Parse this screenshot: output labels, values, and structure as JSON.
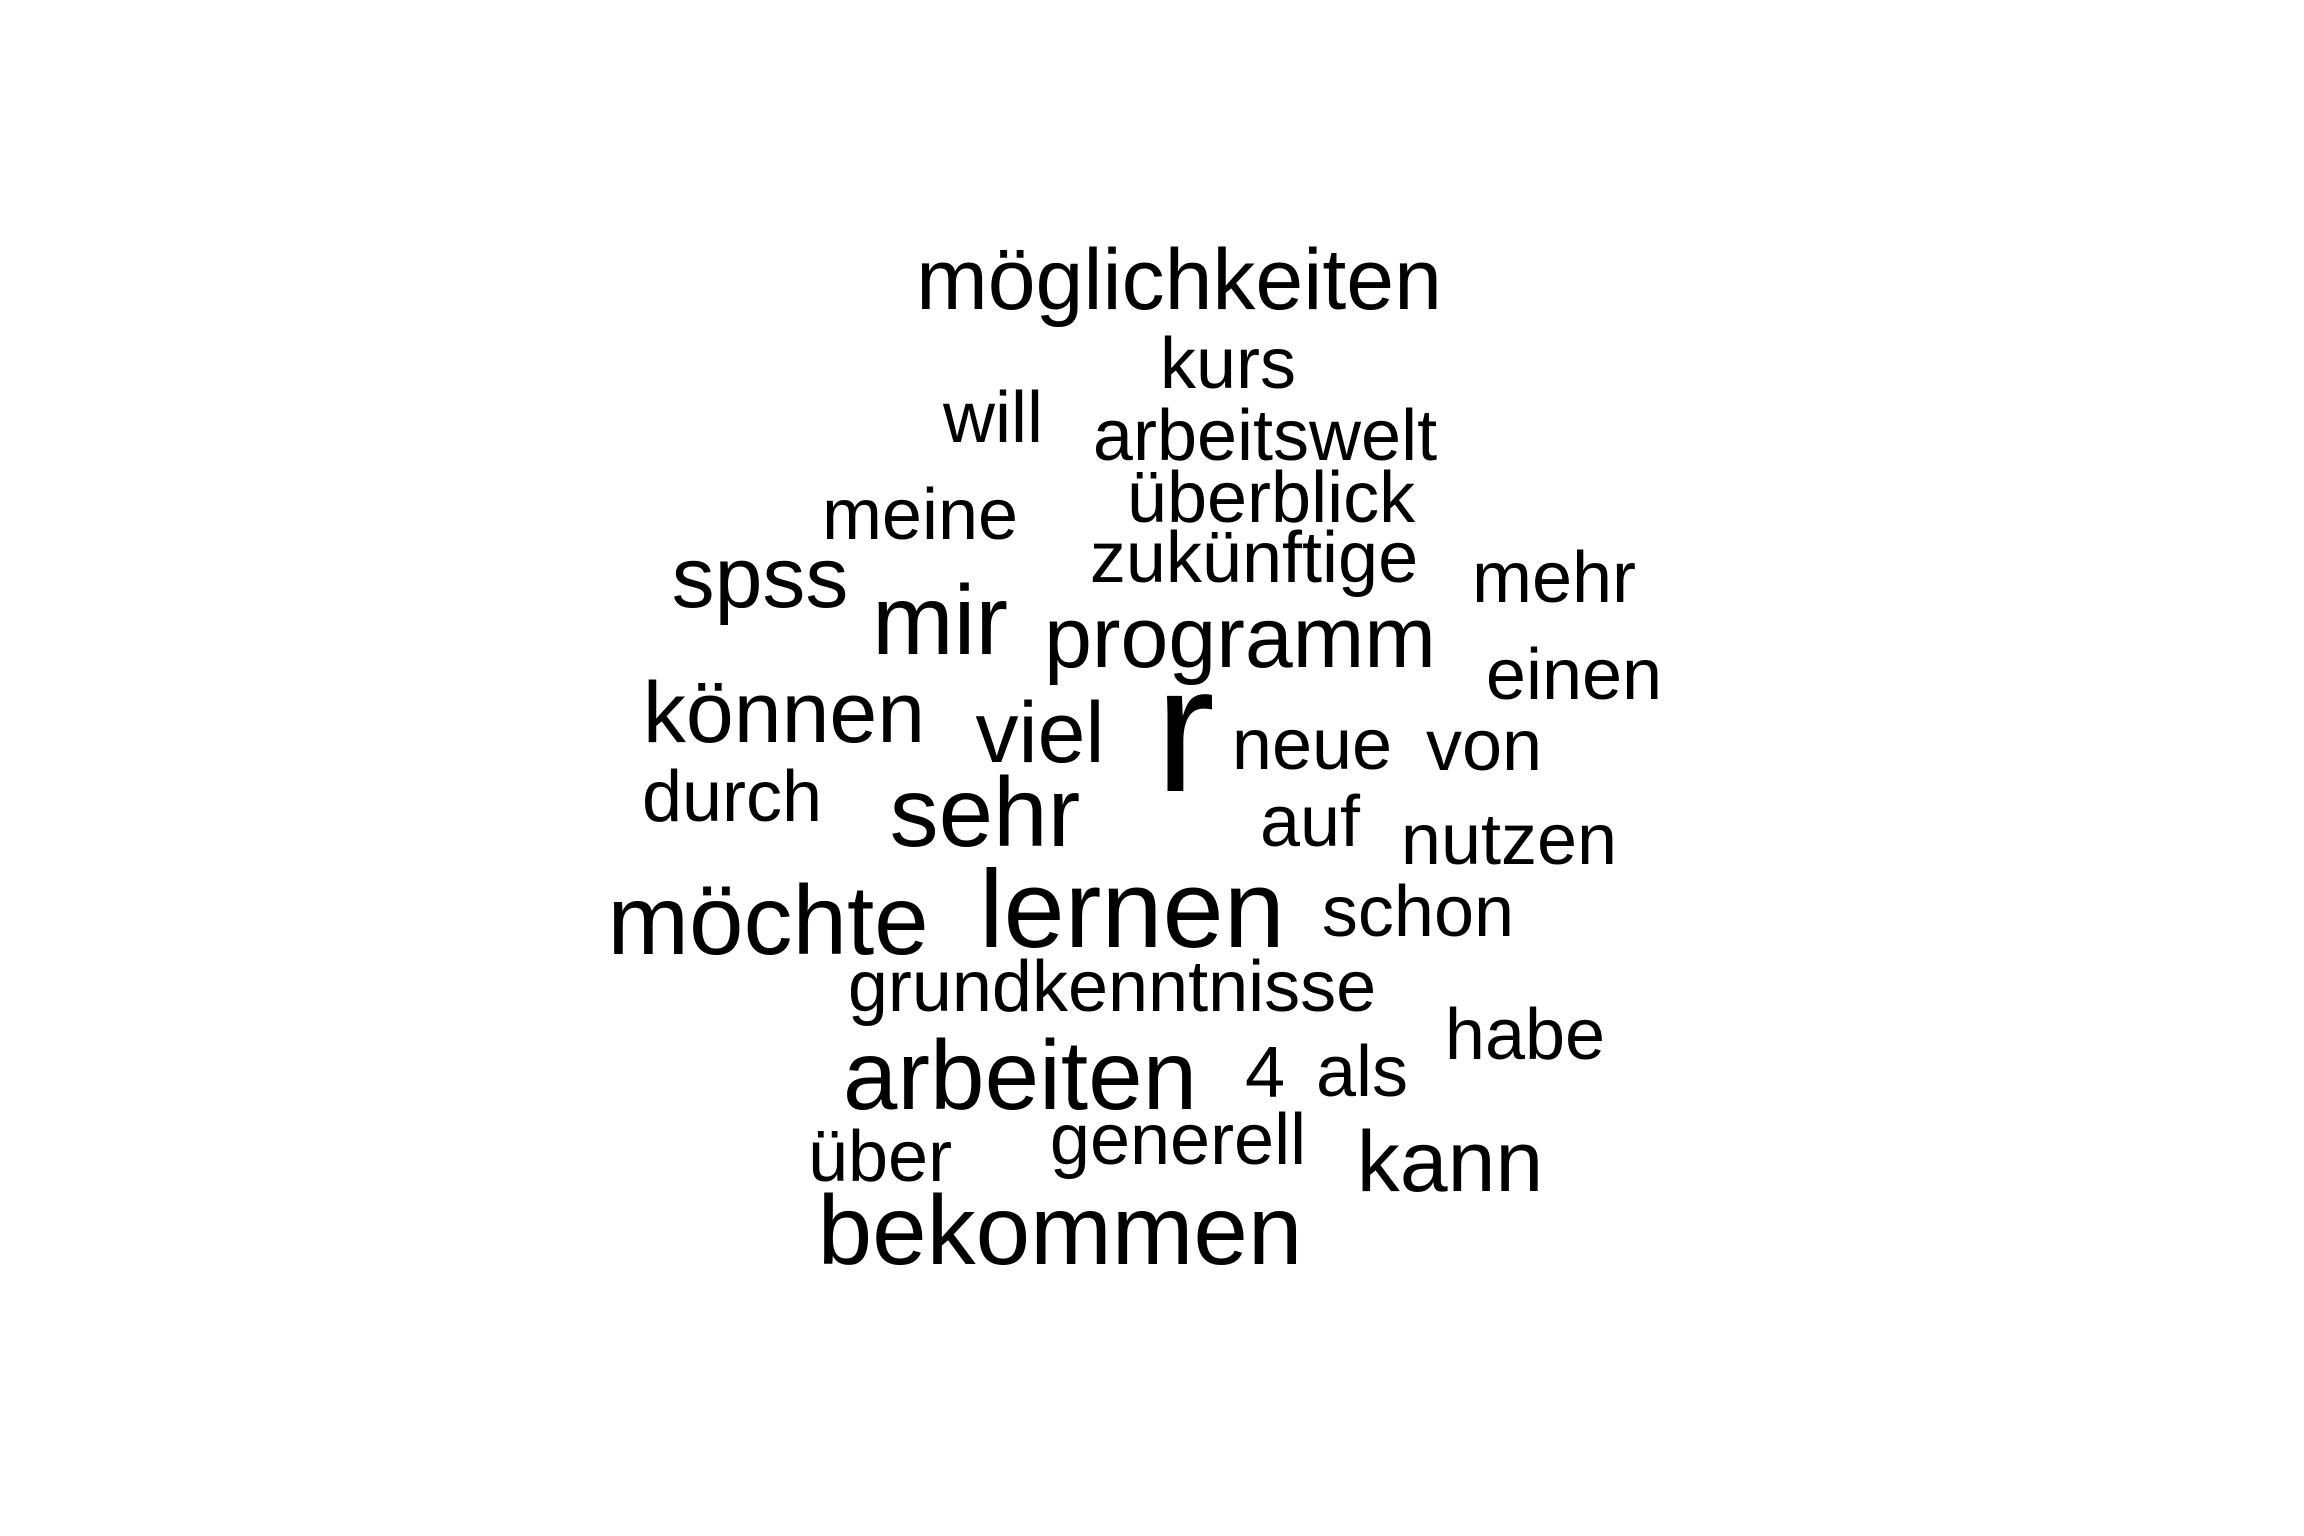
{
  "wordcloud": {
    "text_color": "#000000",
    "background_color": "#ffffff",
    "words": [
      "möglichkeiten",
      "kurs",
      "will",
      "arbeitswelt",
      "meine",
      "überblick",
      "spss",
      "zukünftige",
      "mehr",
      "mir",
      "programm",
      "einen",
      "können",
      "viel",
      "r",
      "neue",
      "von",
      "durch",
      "sehr",
      "auf",
      "nutzen",
      "möchte",
      "lernen",
      "schon",
      "grundkenntnisse",
      "habe",
      "arbeiten",
      "4",
      "als",
      "über",
      "generell",
      "kann",
      "bekommen"
    ]
  }
}
